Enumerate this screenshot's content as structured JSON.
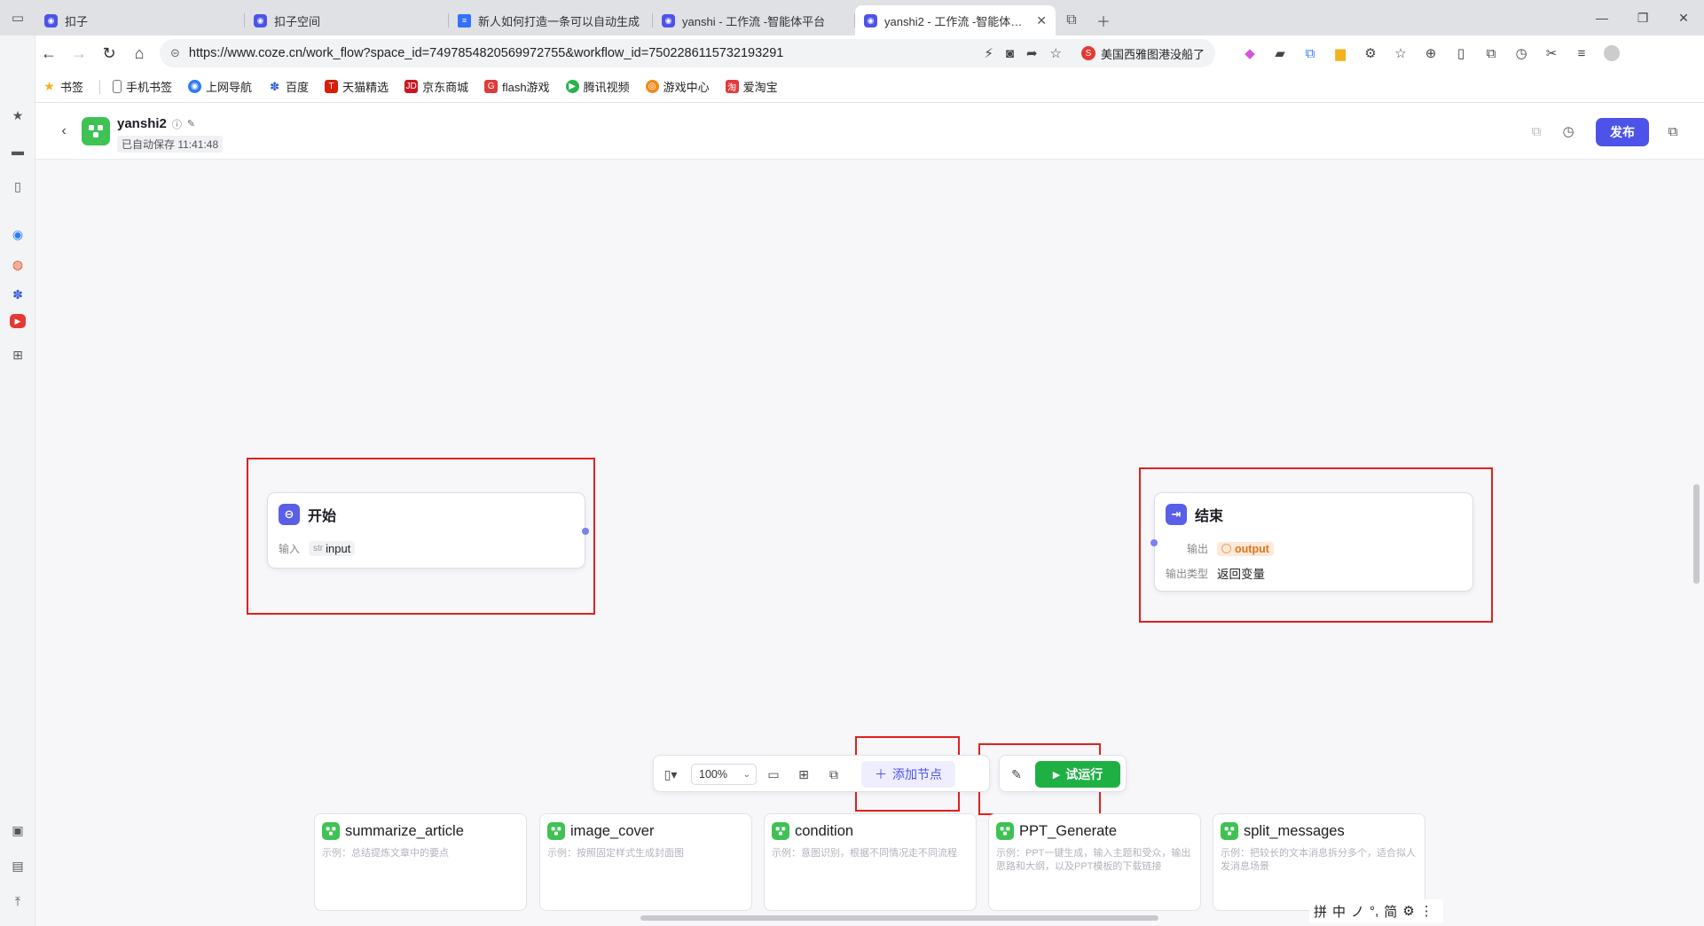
{
  "browser": {
    "tabs": [
      {
        "label": "扣子",
        "active": false
      },
      {
        "label": "扣子空间",
        "active": false
      },
      {
        "label": "新人如何打造一条可以自动生成",
        "active": false
      },
      {
        "label": "yanshi - 工作流 -智能体平台",
        "active": false
      },
      {
        "label": "yanshi2 - 工作流 -智能体平台",
        "active": true
      }
    ],
    "url": "https://www.coze.cn/work_flow?space_id=7497854820569972755&workflow_id=7502286115732193291",
    "news_text": "美国西雅图港没船了",
    "bookmarks": [
      "书签",
      "手机书签",
      "上网导航",
      "百度",
      "天猫精选",
      "京东商城",
      "flash游戏",
      "腾讯视频",
      "游戏中心",
      "爱淘宝"
    ]
  },
  "header": {
    "workflow_name": "yanshi2",
    "saved_text": "已自动保存 11:41:48",
    "publish_label": "发布"
  },
  "nodes": {
    "start": {
      "title": "开始",
      "input_label": "输入",
      "input_type": "str",
      "input_name": "input"
    },
    "end": {
      "title": "结束",
      "output_label": "输出",
      "output_name": "output",
      "output_type_label": "输出类型",
      "output_type_value": "返回变量"
    }
  },
  "toolbar": {
    "zoom": "100%",
    "add_node_label": "添加节点",
    "test_run_label": "试运行"
  },
  "templates": [
    {
      "name": "summarize_article",
      "desc": "示例：总结提炼文章中的要点"
    },
    {
      "name": "image_cover",
      "desc": "示例：按照固定样式生成封面图"
    },
    {
      "name": "condition",
      "desc": "示例：意图识别，根据不同情况走不同流程"
    },
    {
      "name": "PPT_Generate",
      "desc": "示例：PPT一键生成，输入主题和受众，输出思路和大纲，以及PPT模板的下载链接"
    },
    {
      "name": "split_messages",
      "desc": "示例：把较长的文本消息拆分多个，适合拟人发消息场景"
    }
  ],
  "ime": [
    "拼",
    "中",
    "ノ",
    "°,",
    "简",
    "⚙",
    "⋮"
  ],
  "colors": {
    "brand": "#4d53e8",
    "run_green": "#1fb043",
    "workflow_icon_green": "#3ec254",
    "highlight_red": "#e0201d"
  }
}
